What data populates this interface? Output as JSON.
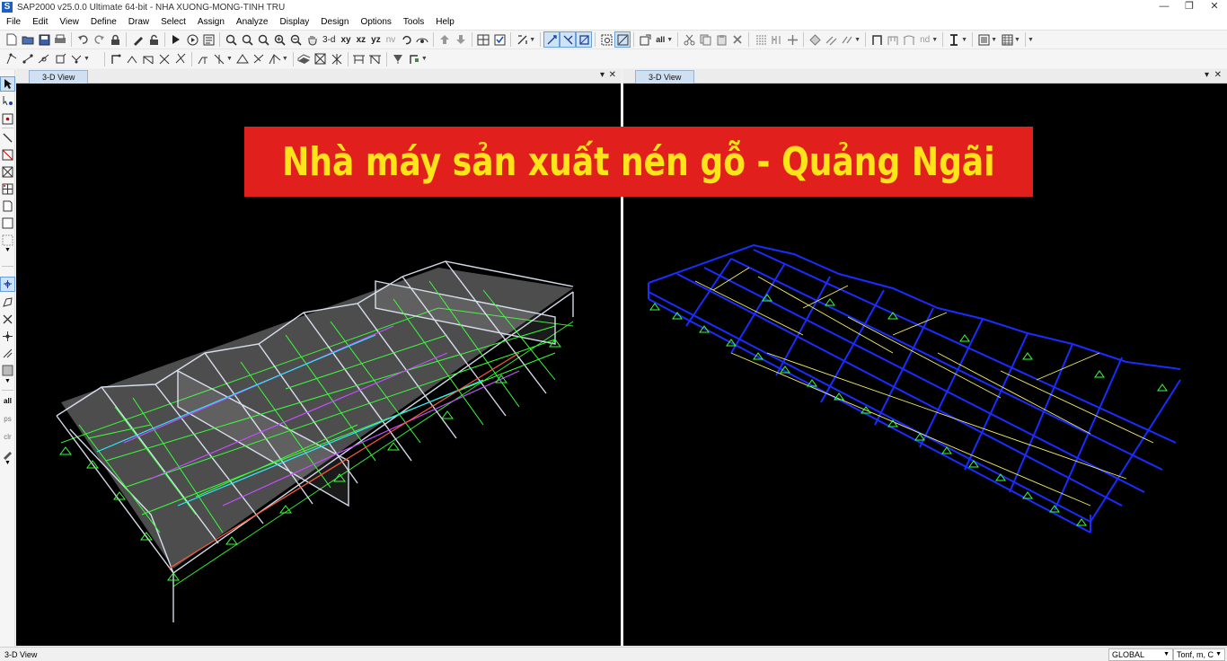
{
  "window": {
    "title": "SAP2000 v25.0.0 Ultimate 64-bit - NHA XUONG-MONG-TINH TRU",
    "logo_letter": "S",
    "minimize": "—",
    "restore": "❐",
    "close": "✕"
  },
  "menu": [
    "File",
    "Edit",
    "View",
    "Define",
    "Draw",
    "Select",
    "Assign",
    "Analyze",
    "Display",
    "Design",
    "Options",
    "Tools",
    "Help"
  ],
  "toolbar": {
    "view_3d": "3-d",
    "view_xy": "xy",
    "view_xz": "xz",
    "view_yz": "yz",
    "view_nv": "nv",
    "label_nd": "nd",
    "label_all": "all"
  },
  "left_toolbar": {
    "label_all": "all",
    "label_ps": "ps",
    "label_clr": "clr"
  },
  "panes": {
    "left": {
      "tab": "3-D View",
      "dropdown": "▾",
      "close": "✕"
    },
    "right": {
      "tab": "3-D View",
      "dropdown": "▾",
      "close": "✕"
    }
  },
  "banner": {
    "text": "Nhà máy sản xuất nén gỗ - Quảng Ngãi"
  },
  "colors": {
    "banner_bg": "#e1201e",
    "banner_text": "#ffe41a",
    "viewport_bg": "#000000",
    "frame_left_white": "#e8f0ff",
    "frame_left_green": "#39ff39",
    "frame_right_blue": "#1a2cff",
    "frame_right_yellow": "#f5f06a"
  },
  "status": {
    "view": "3-D View",
    "coord_system": "GLOBAL",
    "units": "Tonf, m, C"
  }
}
